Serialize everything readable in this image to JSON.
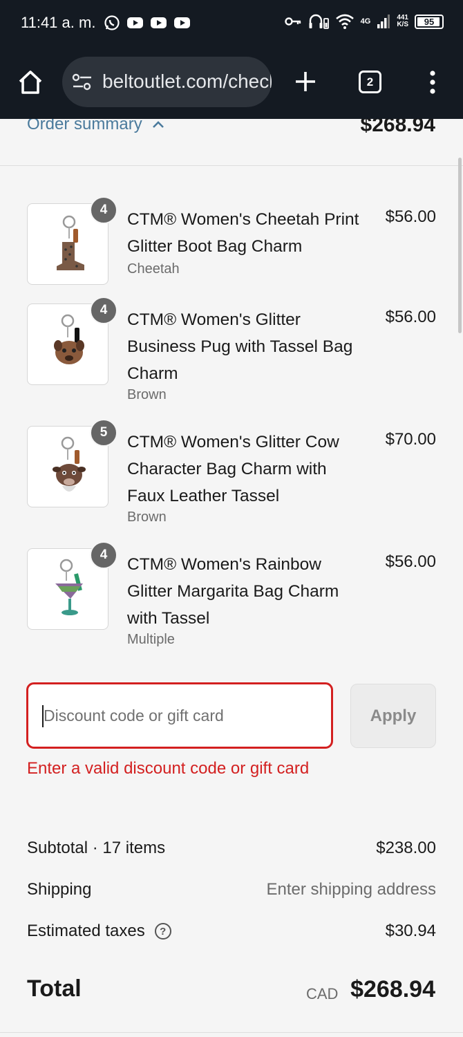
{
  "status_bar": {
    "time": "11:41 a. m.",
    "battery": "95",
    "battery_level": 0.95,
    "network": "4G",
    "net_speed_value": "441",
    "net_speed_unit": "K/S"
  },
  "browser": {
    "url": "beltoutlet.com/checkout",
    "tab_count": "2"
  },
  "order_summary": {
    "toggle_label": "Order summary",
    "total": "$268.94"
  },
  "items": [
    {
      "title": "CTM® Women's Cheetah Print Glitter Boot Bag Charm",
      "variant": "Cheetah",
      "price": "$56.00",
      "quantity": "4"
    },
    {
      "title": "CTM® Women's Glitter Business Pug with Tassel Bag Charm",
      "variant": "Brown",
      "price": "$56.00",
      "quantity": "4"
    },
    {
      "title": "CTM® Women's Glitter Cow Character Bag Charm with Faux Leather Tassel",
      "variant": "Brown",
      "price": "$70.00",
      "quantity": "5"
    },
    {
      "title": "CTM® Women's Rainbow Glitter Margarita Bag Charm with Tassel",
      "variant": "Multiple",
      "price": "$56.00",
      "quantity": "4"
    }
  ],
  "discount": {
    "placeholder": "Discount code or gift card",
    "value": "",
    "apply_label": "Apply",
    "error": "Enter a valid discount code or gift card"
  },
  "totals": {
    "subtotal_label": "Subtotal · 17 items",
    "subtotal_value": "$238.00",
    "shipping_label": "Shipping",
    "shipping_value": "Enter shipping address",
    "taxes_label": "Estimated taxes",
    "taxes_value": "$30.94",
    "total_label": "Total",
    "currency": "CAD",
    "total_value": "$268.94"
  },
  "colors": {
    "error": "#d32020",
    "link": "#4a7a9c",
    "chrome_bg": "#141a22"
  }
}
